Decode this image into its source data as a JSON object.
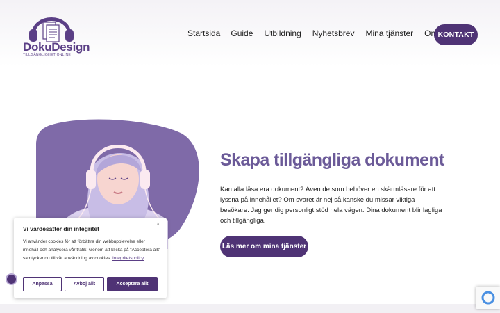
{
  "brand": {
    "name": "DokuDesign",
    "tagline": "TILLGÄNGLIGHET ONLINE"
  },
  "nav": {
    "items": [
      "Startsida",
      "Guide",
      "Utbildning",
      "Nyhetsbrev",
      "Mina tjänster",
      "Om mig"
    ],
    "contact_label": "KONTAKT"
  },
  "hero": {
    "title": "Skapa tillgängliga dokument",
    "text": "Kan alla läsa era dokument? Även de som behöver en skärmläsare för att lyssna på innehållet? Om svaret är nej så kanske du missar viktiga besökare. Jag ger dig personligt stöd hela vägen. Dina dokument blir lagliga och tillgängliga.",
    "button_label": "Läs mer om mina tjänster"
  },
  "cookie": {
    "title": "Vi värdesätter din integritet",
    "text": "Vi använder cookies för att förbättra din webbupplevelse eller innehåll och analysera vår trafik. Genom att klicka på \"Acceptera allt\" samtycker du till vår användning av cookies.",
    "link_label": "Integritetspolicy",
    "customize_label": "Anpassa",
    "reject_label": "Avböj allt",
    "accept_label": "Acceptera allt",
    "close_symbol": "×"
  },
  "colors": {
    "brand_purple": "#4f3375",
    "title_purple": "#6b5a98",
    "art_purple": "#7f6aa8"
  },
  "icons": [
    "headphones-logo-icon",
    "accessibility-icon",
    "recaptcha-icon",
    "close-icon"
  ]
}
